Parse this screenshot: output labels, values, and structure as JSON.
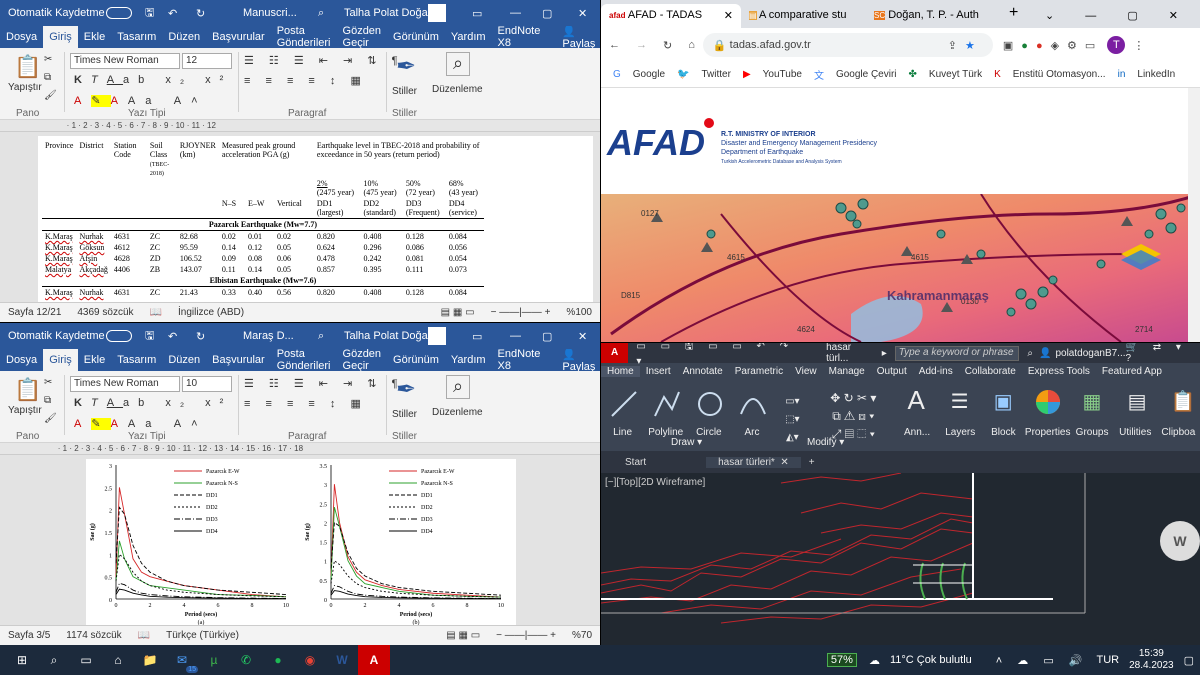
{
  "word1": {
    "autosave": "Otomatik Kaydetme",
    "title": "Manuscri...",
    "user": "Talha Polat Doğan",
    "menu": [
      "Dosya",
      "Giriş",
      "Ekle",
      "Tasarım",
      "Düzen",
      "Başvurular",
      "Posta Gönderileri",
      "Gözden Geçir",
      "Görünüm",
      "Yardım",
      "EndNote X8"
    ],
    "share": "Paylaş",
    "paste": "Yapıştır",
    "font": "Times New Roman",
    "size": "12",
    "styles": "Stiller",
    "edit": "Düzenleme",
    "groups": [
      "Pano",
      "Yazı Tipi",
      "Paragraf",
      "Stiller"
    ],
    "table": {
      "h_province": "Province",
      "h_district": "District",
      "h_station": "Station Code",
      "h_soil": "Soil Class",
      "h_soil_sub": "(TBEC-2018)",
      "h_r": "RJOYNER (km)",
      "h_pga": "Measured peak ground acceleration PGA (g)",
      "h_eq": "Earthquake level in TBEC-2018 and probability of exceedance in 50 years (return period)",
      "p1": "2%",
      "p1b": "(2475 year)",
      "p2": "10%",
      "p2b": "(475 year)",
      "p3": "50%",
      "p3b": "(72 year)",
      "p4": "68%",
      "p4b": "(43 year)",
      "ns": "N–S",
      "ew": "E–W",
      "vert": "Vertical",
      "dd1": "DD1",
      "dd1b": "(largest)",
      "dd2": "DD2",
      "dd2b": "(standard)",
      "dd3": "DD3",
      "dd3b": "(Frequent)",
      "dd4": "DD4",
      "dd4b": "(service)",
      "sec1": "Pazarcık Earthquake (Mw=7.7)",
      "rows1": [
        [
          "K.Maraş",
          "Nurhak",
          "4631",
          "ZC",
          "82.68",
          "0.02",
          "0.01",
          "0.02",
          "0.820",
          "0.408",
          "0.128",
          "0.084"
        ],
        [
          "K.Maraş",
          "Göksun",
          "4612",
          "ZC",
          "95.59",
          "0.14",
          "0.12",
          "0.05",
          "0.624",
          "0.296",
          "0.086",
          "0.056"
        ],
        [
          "K.Maraş",
          "Afşin",
          "4628",
          "ZD",
          "106.52",
          "0.09",
          "0.08",
          "0.06",
          "0.478",
          "0.242",
          "0.081",
          "0.054"
        ],
        [
          "Malatya",
          "Akçadağ",
          "4406",
          "ZB",
          "143.07",
          "0.11",
          "0.14",
          "0.05",
          "0.857",
          "0.395",
          "0.111",
          "0.073"
        ]
      ],
      "sec2": "Elbistan Earthquake (Mw=7.6)",
      "rows2": [
        [
          "K.Maraş",
          "Nurhak",
          "4631",
          "ZC",
          "21.43",
          "0.33",
          "0.40",
          "0.56",
          "0.820",
          "0.408",
          "0.128",
          "0.084"
        ]
      ]
    },
    "status": {
      "page": "Sayfa 12/21",
      "words": "4369 sözcük",
      "lang": "İngilizce (ABD)",
      "zoom": "%100"
    }
  },
  "word2": {
    "autosave": "Otomatik Kaydetme",
    "title": "Maraş D...",
    "user": "Talha Polat Doğan",
    "font": "Times New Roman",
    "size": "10",
    "status": {
      "page": "Sayfa 3/5",
      "words": "1174 sözcük",
      "lang": "Türkçe (Türkiye)",
      "zoom": "%70"
    },
    "chart_data": [
      {
        "type": "line",
        "xlabel": "Period (secs)",
        "ylabel": "Sae (g)",
        "xlim": [
          0,
          10
        ],
        "ylim": [
          0,
          3
        ],
        "legend": [
          "Pazarcık E-W",
          "Pazarcık N-S",
          "DD1",
          "DD2",
          "DD3",
          "DD4"
        ],
        "sublabel": "(a)",
        "x": [
          0,
          0.2,
          0.5,
          1,
          1.5,
          2,
          3,
          4,
          6,
          8,
          10
        ],
        "series": [
          {
            "name": "Pazarcık E-W",
            "values": [
              0.5,
              2.5,
              1.9,
              0.9,
              0.6,
              0.5,
              0.4,
              0.3,
              0.2,
              0.1,
              0.05
            ]
          },
          {
            "name": "Pazarcık N-S",
            "values": [
              0.4,
              1.3,
              0.9,
              0.5,
              0.4,
              0.3,
              0.25,
              0.2,
              0.1,
              0.08,
              0.05
            ]
          },
          {
            "name": "DD1",
            "values": [
              0.8,
              2.05,
              1.9,
              1.2,
              0.8,
              0.6,
              0.4,
              0.3,
              0.2,
              0.15,
              0.1
            ]
          },
          {
            "name": "DD2",
            "values": [
              0.4,
              1.0,
              0.9,
              0.6,
              0.4,
              0.3,
              0.2,
              0.15,
              0.1,
              0.07,
              0.05
            ]
          },
          {
            "name": "DD3",
            "values": [
              0.15,
              0.35,
              0.32,
              0.2,
              0.13,
              0.1,
              0.07,
              0.05,
              0.03,
              0.02,
              0.01
            ]
          },
          {
            "name": "DD4",
            "values": [
              0.1,
              0.22,
              0.2,
              0.13,
              0.09,
              0.06,
              0.04,
              0.03,
              0.02,
              0.01,
              0.01
            ]
          }
        ]
      },
      {
        "type": "line",
        "xlabel": "Period (secs)",
        "ylabel": "Sae (g)",
        "xlim": [
          0,
          10
        ],
        "ylim": [
          0,
          3.5
        ],
        "legend": [
          "Pazarcık E-W",
          "Pazarcık N-S",
          "DD1",
          "DD2",
          "DD3",
          "DD4"
        ],
        "sublabel": "(b)",
        "x": [
          0,
          0.2,
          0.5,
          1,
          1.5,
          2,
          3,
          4,
          6,
          8,
          10
        ],
        "series": [
          {
            "name": "Pazarcık E-W",
            "values": [
              0.6,
              3.0,
              2.0,
              1.1,
              0.7,
              0.5,
              0.35,
              0.25,
              0.15,
              0.1,
              0.05
            ]
          },
          {
            "name": "Pazarcık N-S",
            "values": [
              0.5,
              2.4,
              1.9,
              1.0,
              0.6,
              0.4,
              0.3,
              0.2,
              0.1,
              0.07,
              0.05
            ]
          },
          {
            "name": "DD1",
            "values": [
              0.8,
              2.0,
              1.9,
              1.2,
              0.8,
              0.6,
              0.4,
              0.3,
              0.2,
              0.15,
              0.1
            ]
          },
          {
            "name": "DD2",
            "values": [
              0.4,
              1.0,
              0.9,
              0.6,
              0.4,
              0.3,
              0.2,
              0.15,
              0.1,
              0.07,
              0.05
            ]
          },
          {
            "name": "DD3",
            "values": [
              0.15,
              0.35,
              0.32,
              0.2,
              0.13,
              0.1,
              0.07,
              0.05,
              0.03,
              0.02,
              0.01
            ]
          },
          {
            "name": "DD4",
            "values": [
              0.1,
              0.22,
              0.2,
              0.13,
              0.09,
              0.06,
              0.04,
              0.03,
              0.02,
              0.01,
              0.01
            ]
          }
        ]
      }
    ]
  },
  "chrome": {
    "tabs": [
      "AFAD - TADAS",
      "A comparative stu",
      "Doğan, T. P. - Auth"
    ],
    "url": "tadas.afad.gov.tr",
    "profile": "T",
    "bookmarks": [
      "Google",
      "Twitter",
      "YouTube",
      "Google Çeviri",
      "Kuveyt Türk",
      "Enstitü Otomasyon...",
      "LinkedIn"
    ],
    "afad_logo": "AFAD",
    "ministry": "R.T. MINISTRY OF INTERIOR",
    "presidency": "Disaster and Emergency Management Presidency",
    "dept": "Department of Earthquake",
    "db": "Turkish Accelerometric Database and Analysis System",
    "map_city": "Kahramanmaraş",
    "map_labels": [
      "0127",
      "4615",
      "4615",
      "2714",
      "D815",
      "4624",
      "0130"
    ]
  },
  "acad": {
    "title": "hasar türl...",
    "search": "Type a keyword or phrase",
    "user": "polatdoganB7...",
    "menu": [
      "Home",
      "Insert",
      "Annotate",
      "Parametric",
      "View",
      "Manage",
      "Output",
      "Add-ins",
      "Collaborate",
      "Express Tools",
      "Featured App"
    ],
    "draw_tools": [
      "Line",
      "Polyline",
      "Circle",
      "Arc"
    ],
    "big_tools": [
      "Ann...",
      "Layers",
      "Block",
      "Properties",
      "Groups",
      "Utilities",
      "Clipboa"
    ],
    "groups": [
      "Draw",
      "Modify"
    ],
    "tabs": [
      "Start",
      "hasar türleri*"
    ],
    "viewport": "[−][Top][2D Wireframe]",
    "w": "W"
  },
  "taskbar": {
    "battery": "57%",
    "weather": "11°C Çok bulutlu",
    "lang": "TUR",
    "time": "15:39",
    "date": "28.4.2023",
    "badge": "15"
  }
}
